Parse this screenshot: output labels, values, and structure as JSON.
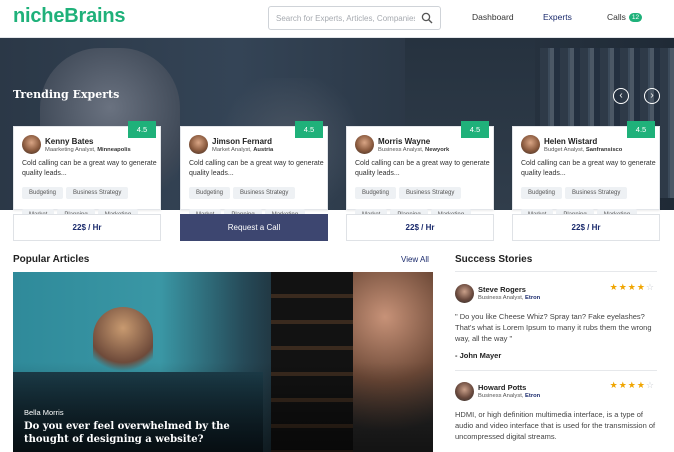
{
  "brand": {
    "name": "nicheBrains",
    "color": "#1fb17a"
  },
  "search": {
    "placeholder": "Search for Experts, Articles, Companies",
    "icon": "search-icon"
  },
  "nav": {
    "dashboard": "Dashboard",
    "experts": "Experts",
    "calls": "Calls",
    "calls_count": "12"
  },
  "hero": {
    "title": "Trending Experts",
    "prev_icon": "chevron-left-icon",
    "next_icon": "chevron-right-icon"
  },
  "experts": [
    {
      "name": "Kenny Bates",
      "role": "Maarketing Analyst, ",
      "location": "Minneapolis",
      "rating": "4.5",
      "desc": "Cold calling can be a great way to generate quality leads...",
      "tags": [
        "Budgeting",
        "Business Strategy",
        "Market",
        "Planning",
        "Marketing"
      ],
      "cta": "22$ / Hr"
    },
    {
      "name": "Jimson Fernard",
      "role": "Market Analyst, ",
      "location": "Austria",
      "rating": "4.5",
      "desc": "Cold calling can be a great way to generate quality leads...",
      "tags": [
        "Budgeting",
        "Business Strategy",
        "Market",
        "Planning",
        "Marketing"
      ],
      "cta": "Request a Call"
    },
    {
      "name": "Morris Wayne",
      "role": "Business Analyst, ",
      "location": "Newyork",
      "rating": "4.5",
      "desc": "Cold calling can be a great way to generate quality leads...",
      "tags": [
        "Budgeting",
        "Business Strategy",
        "Market",
        "Planning",
        "Marketing"
      ],
      "cta": "22$ / Hr"
    },
    {
      "name": "Helen Wistard",
      "role": "Budget Analyst, ",
      "location": "Sanfransisco",
      "rating": "4.5",
      "desc": "Cold calling can be a great way to generate quality leads...",
      "tags": [
        "Budgeting",
        "Business Strategy",
        "Market",
        "Planning",
        "Marketing"
      ],
      "cta": "22$ / Hr"
    }
  ],
  "articles": {
    "title": "Popular Articles",
    "view_all": "View All",
    "featured": {
      "author": "Bella Morris",
      "title": "Do you ever feel overwhelmed by the thought of designing a website?"
    }
  },
  "stories": {
    "title": "Success Stories",
    "items": [
      {
        "name": "Steve Rogers",
        "role": "Business Analyst, ",
        "company": "Etron",
        "stars": 4,
        "max_stars": 5,
        "text": "\" Do you like Cheese Whiz? Spray tan? Fake eyelashes? That's what is Lorem Ipsum to many it rubs them the wrong way, all the way \"",
        "author": "- John Mayer"
      },
      {
        "name": "Howard Potts",
        "role": "Business Analyst, ",
        "company": "Etron",
        "stars": 4,
        "max_stars": 5,
        "text": "HDMI, or high definition multimedia interface, is a type of audio and video interface that is used for the transmission of uncompressed digital streams.",
        "author": ""
      }
    ]
  },
  "colors": {
    "accent": "#1fb17a",
    "navy": "#1a2a6c",
    "cta": "#3d4670",
    "star": "#f0a500"
  }
}
